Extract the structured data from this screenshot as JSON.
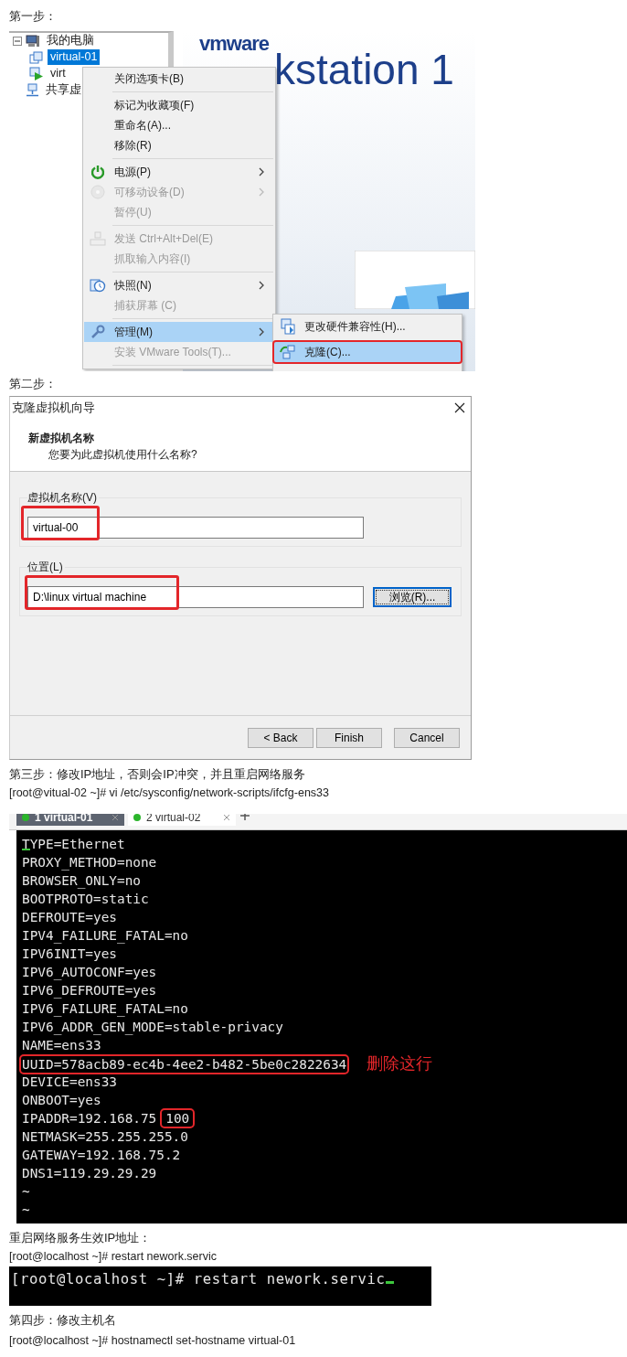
{
  "step1": {
    "heading": "第一步：",
    "tree": [
      {
        "label": "我的电脑",
        "kind": "computer",
        "expanded": true,
        "selected": false,
        "children": [
          {
            "label": "virtual-01",
            "kind": "vm",
            "selected": true
          },
          {
            "label": "virt",
            "kind": "vm-running",
            "selected": false
          }
        ]
      },
      {
        "label": "共享虚",
        "kind": "shared",
        "selected": false
      }
    ],
    "logo": "vmware",
    "product_text": "kstation 1",
    "context_menu": [
      {
        "kind": "item",
        "label": "关闭选项卡(B)",
        "disabled": false,
        "submenu": false,
        "selected": false
      },
      {
        "kind": "separator"
      },
      {
        "kind": "item",
        "label": "标记为收藏项(F)",
        "disabled": false,
        "submenu": false,
        "selected": false
      },
      {
        "kind": "item",
        "label": "重命名(A)...",
        "disabled": false,
        "submenu": false,
        "selected": false
      },
      {
        "kind": "item",
        "label": "移除(R)",
        "disabled": false,
        "submenu": false,
        "selected": false
      },
      {
        "kind": "separator"
      },
      {
        "kind": "item",
        "label": "电源(P)",
        "disabled": false,
        "submenu": true,
        "selected": false
      },
      {
        "kind": "item",
        "label": "可移动设备(D)",
        "disabled": true,
        "submenu": true,
        "selected": false
      },
      {
        "kind": "item",
        "label": "暂停(U)",
        "disabled": true,
        "submenu": false,
        "selected": false
      },
      {
        "kind": "separator"
      },
      {
        "kind": "item",
        "label": "发送 Ctrl+Alt+Del(E)",
        "disabled": true,
        "submenu": false,
        "selected": false
      },
      {
        "kind": "item",
        "label": "抓取输入内容(I)",
        "disabled": true,
        "submenu": false,
        "selected": false
      },
      {
        "kind": "separator"
      },
      {
        "kind": "item",
        "label": "快照(N)",
        "disabled": false,
        "submenu": true,
        "selected": false
      },
      {
        "kind": "item",
        "label": "捕获屏幕 (C)",
        "disabled": true,
        "submenu": false,
        "selected": false
      },
      {
        "kind": "separator"
      },
      {
        "kind": "item",
        "label": "管理(M)",
        "disabled": false,
        "submenu": true,
        "selected": true
      },
      {
        "kind": "item",
        "label": "安装 VMware Tools(T)...",
        "disabled": true,
        "submenu": false,
        "selected": false
      },
      {
        "kind": "separator"
      }
    ],
    "submenu": [
      {
        "label": "更改硬件兼容性(H)...",
        "selected": false,
        "highlighted": false
      },
      {
        "label": "克隆(C)...",
        "selected": true,
        "highlighted": true
      }
    ]
  },
  "step2": {
    "heading": "第二步：",
    "dialog": {
      "title": "克隆虚拟机向导",
      "heading": "新虚拟机名称",
      "subtitle": "您要为此虚拟机使用什么名称?",
      "fields": [
        {
          "label": "虚拟机名称(V)",
          "value": "virtual-00",
          "highlighted": true
        },
        {
          "label": "位置(L)",
          "value": "D:\\linux virtual machine",
          "highlighted": true,
          "button": {
            "label": "浏览(R)...",
            "focused": true
          }
        }
      ],
      "buttons": [
        {
          "label": "< Back",
          "focused": false
        },
        {
          "label": "Finish",
          "focused": false
        },
        {
          "label": "Cancel",
          "focused": false
        }
      ]
    }
  },
  "step3": {
    "heading": "第三步：修改IP地址，否则会IP冲突，并且重启网络服务",
    "command": "[root@vitual-02 ~]# vi /etc/sysconfig/network-scripts/ifcfg-ens33",
    "terminal": {
      "cursor": true,
      "tabs": [
        {
          "label": "1 virtual-01",
          "selected": true
        },
        {
          "label": "2 virtual-02",
          "selected": false
        }
      ],
      "lines": [
        {
          "text": "TYPE=Ethernet",
          "highlighted": false
        },
        {
          "text": "PROXY_METHOD=none",
          "highlighted": false
        },
        {
          "text": "BROWSER_ONLY=no",
          "highlighted": false
        },
        {
          "text": "BOOTPROTO=static",
          "highlighted": false
        },
        {
          "text": "DEFROUTE=yes",
          "highlighted": false
        },
        {
          "text": "IPV4_FAILURE_FATAL=no",
          "highlighted": false
        },
        {
          "text": "IPV6INIT=yes",
          "highlighted": false
        },
        {
          "text": "IPV6_AUTOCONF=yes",
          "highlighted": false
        },
        {
          "text": "IPV6_DEFROUTE=yes",
          "highlighted": false
        },
        {
          "text": "IPV6_FAILURE_FATAL=no",
          "highlighted": false
        },
        {
          "text": "IPV6_ADDR_GEN_MODE=stable-privacy",
          "highlighted": false
        },
        {
          "text": "NAME=ens33",
          "highlighted": false
        },
        {
          "text": "UUID=578acb89-ec4b-4ee2-b482-5be0c2822634",
          "highlighted": true,
          "note": "删除这行"
        },
        {
          "text": "DEVICE=ens33",
          "highlighted": false
        },
        {
          "text": "ONBOOT=yes",
          "highlighted": false
        },
        {
          "text": "IPADDR=192.168.75",
          "highlighted": false,
          "boxed": "100"
        },
        {
          "text": "NETMASK=255.255.255.0",
          "highlighted": false
        },
        {
          "text": "GATEWAY=192.168.75.2",
          "highlighted": false
        },
        {
          "text": "DNS1=119.29.29.29",
          "highlighted": false
        },
        {
          "text": "~",
          "highlighted": false
        },
        {
          "text": "~",
          "highlighted": false
        }
      ]
    }
  },
  "restart": {
    "heading": "重启网络服务生效IP地址：",
    "command": "[root@localhost ~]# restart nework.servic",
    "terminal": {
      "line": "[root@localhost ~]# restart nework.servic",
      "cursor": true
    }
  },
  "step4": {
    "heading": "第四步：修改主机名",
    "command": "[root@localhost ~]# hostnamectl set-hostname virtual-01"
  }
}
